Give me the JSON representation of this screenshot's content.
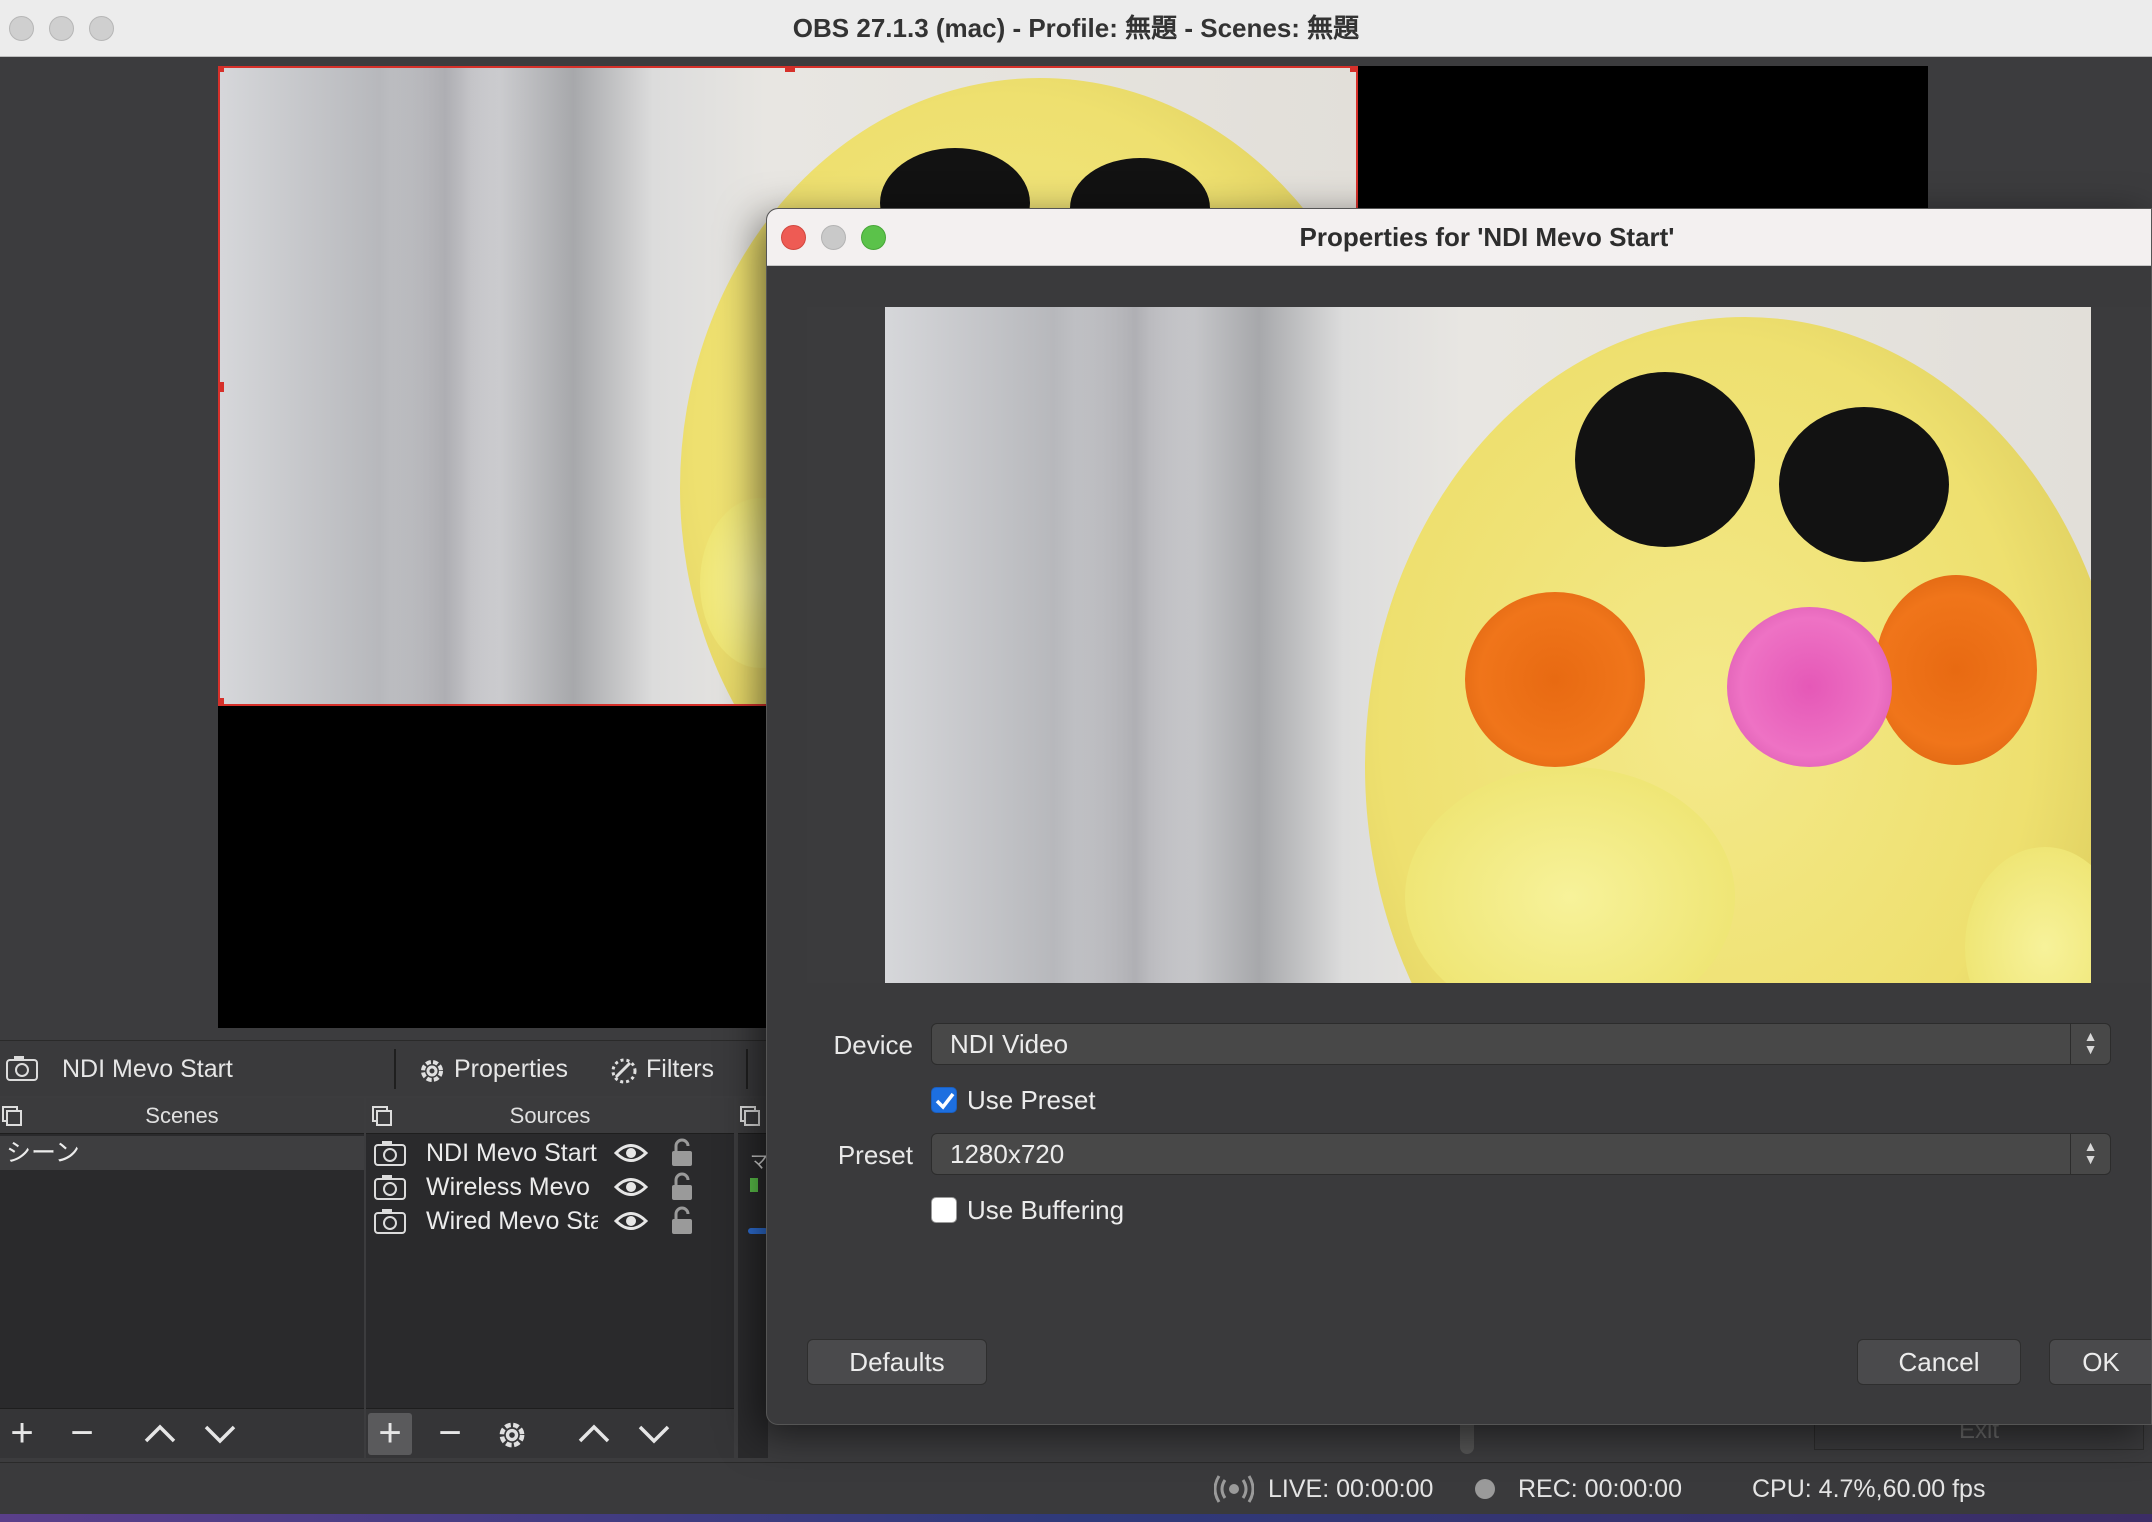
{
  "app": {
    "window_title": "OBS 27.1.3 (mac) - Profile: 無題 - Scenes: 無題"
  },
  "source_toolbar": {
    "selected_source": "NDI Mevo Start",
    "properties_label": "Properties",
    "filters_label": "Filters"
  },
  "scenes_dock": {
    "title": "Scenes",
    "items": [
      "シーン"
    ]
  },
  "sources_dock": {
    "title": "Sources",
    "items": [
      {
        "label": "NDI Mevo Start",
        "visible": true,
        "locked": false
      },
      {
        "label": "Wireless Mevo Start",
        "visible": true,
        "locked": false
      },
      {
        "label": "Wired Mevo Start",
        "visible": true,
        "locked": false
      }
    ]
  },
  "mixer_dock": {
    "partial_label": "マ"
  },
  "controls": {
    "exit_label": "Exit"
  },
  "status_bar": {
    "live": "LIVE: 00:00:00",
    "rec": "REC: 00:00:00",
    "cpu": "CPU: 4.7%,60.00 fps"
  },
  "dialog": {
    "title": "Properties for 'NDI Mevo Start'",
    "device_label": "Device",
    "device_value": "NDI Video",
    "use_preset_label": "Use Preset",
    "use_preset_checked": true,
    "preset_label": "Preset",
    "preset_value": "1280x720",
    "use_buffering_label": "Use Buffering",
    "use_buffering_checked": false,
    "defaults_label": "Defaults",
    "cancel_label": "Cancel",
    "ok_label": "OK"
  },
  "colors": {
    "selection_red": "#d6302a",
    "checkbox_blue": "#1d6fe0",
    "close_red": "#ee5b54",
    "minimize_gray": "#c9c9c9",
    "zoom_green": "#5bc24a"
  }
}
